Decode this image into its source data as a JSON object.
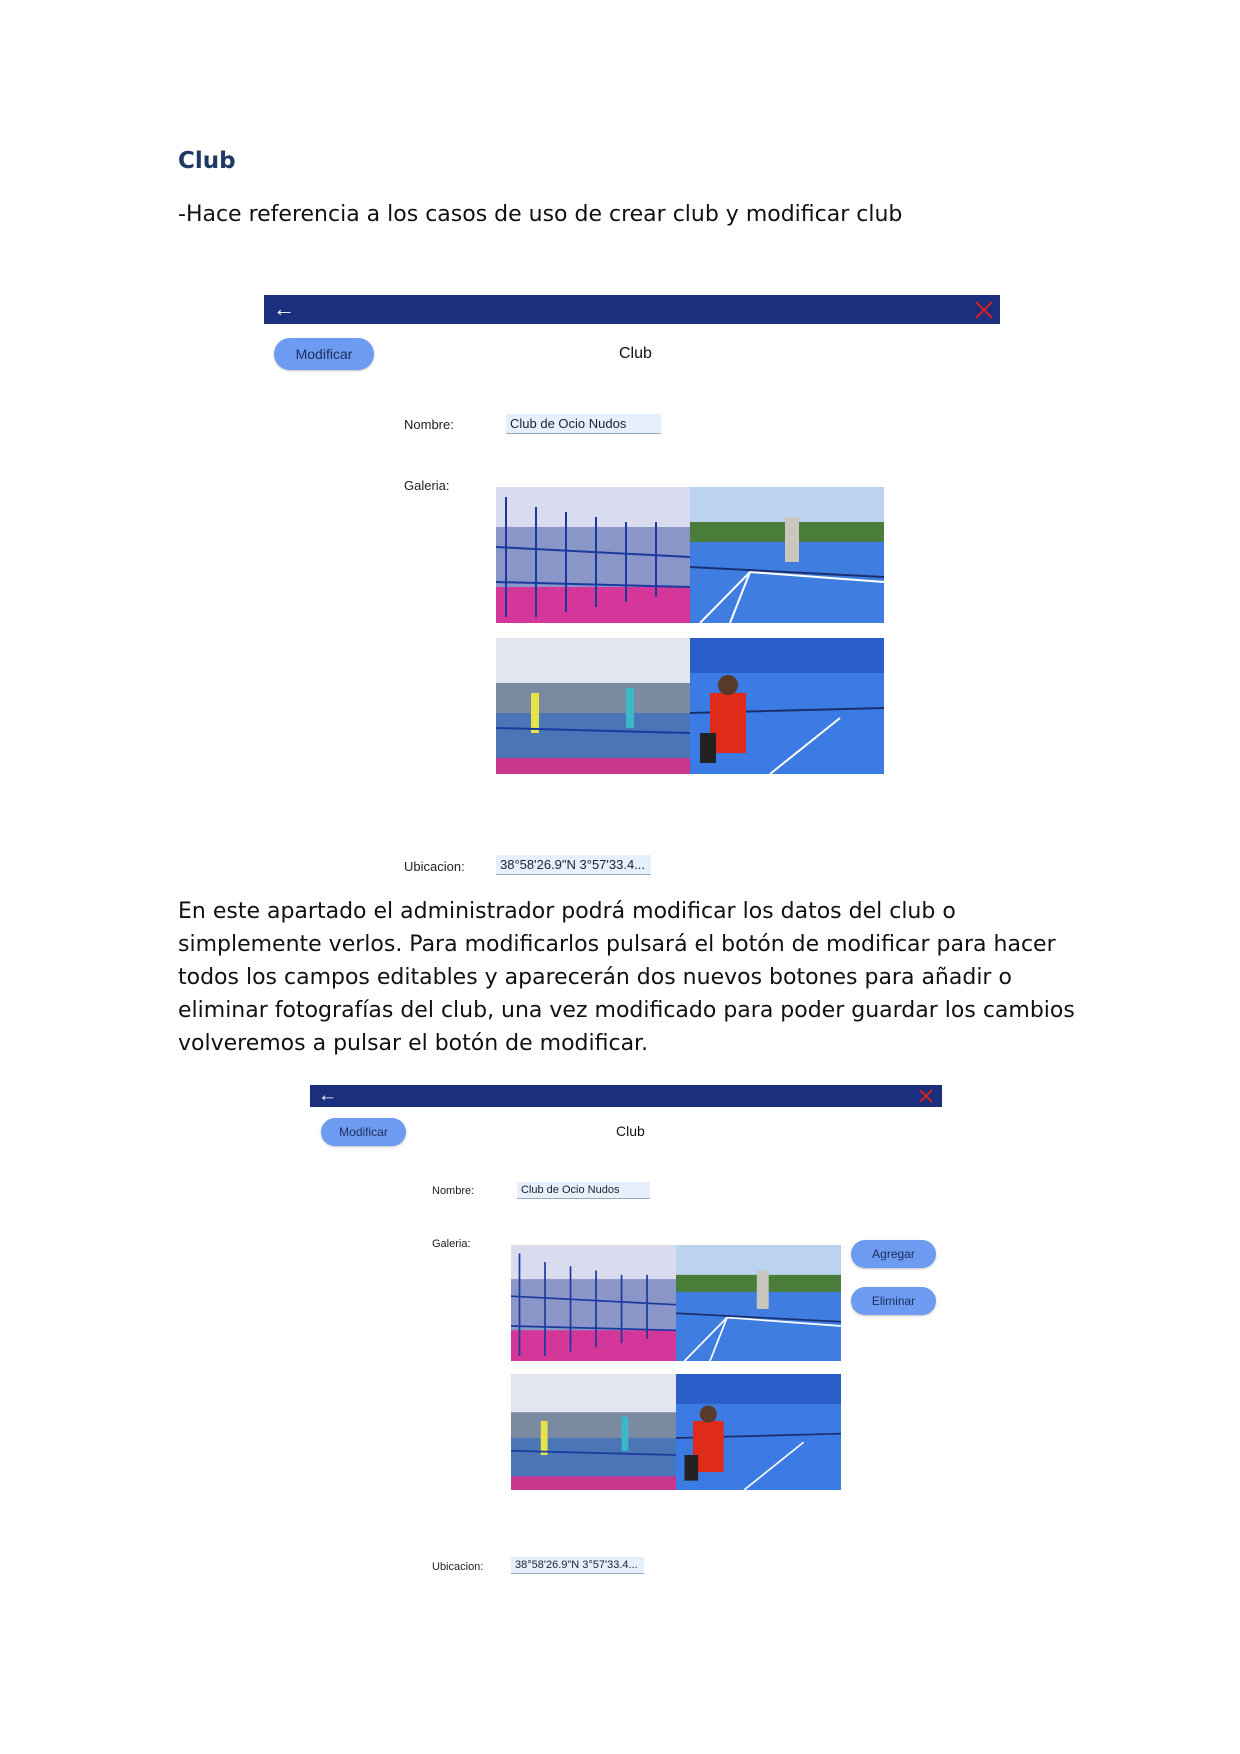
{
  "heading": "Club",
  "intro": "-Hace referencia a los casos de uso de crear club y modificar club",
  "paragraph": "En este apartado el administrador podrá modificar los datos del club o simplemente verlos. Para modificarlos pulsará el botón de modificar para hacer todos los campos editables y aparecerán dos nuevos botones para añadir o eliminar fotografías del club, una vez modificado para poder guardar los cambios volveremos a pulsar el botón de modificar.",
  "screen1": {
    "modify_label": "Modificar",
    "title": "Club",
    "name_label": "Nombre:",
    "name_value": "Club de Ocio Nudos",
    "gallery_label": "Galeria:",
    "location_label": "Ubicacion:",
    "location_value": "38°58'26.9\"N 3°57'33.4..."
  },
  "screen2": {
    "modify_label": "Modificar",
    "title": "Club",
    "name_label": "Nombre:",
    "name_value": "Club de Ocio Nudos",
    "gallery_label": "Galeria:",
    "add_label": "Agregar",
    "delete_label": "Eliminar",
    "location_label": "Ubicacion:",
    "location_value": "38°58'26.9\"N 3°57'33.4..."
  },
  "colors": {
    "bar": "#1a2f7e",
    "button": "#6d9bf2",
    "heading": "#1f3864",
    "close": "#d42020"
  },
  "photos": [
    "indoor-padel-courts",
    "outdoor-padel-courts",
    "players-on-indoor-court",
    "player-in-red-shirt"
  ]
}
